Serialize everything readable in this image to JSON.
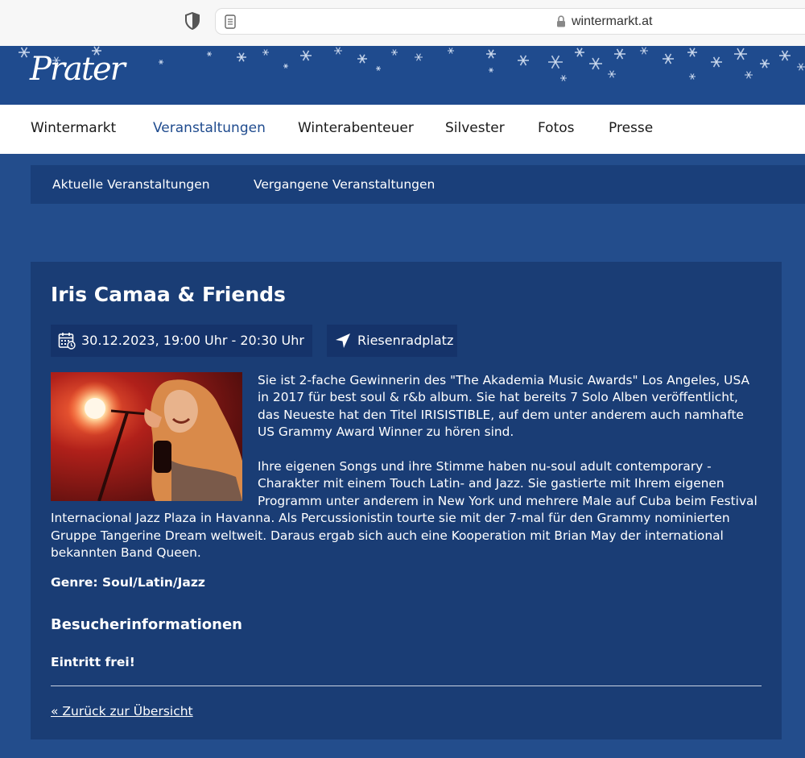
{
  "browser": {
    "url": "wintermarkt.at"
  },
  "header": {
    "logo_text": "Prater"
  },
  "main_nav": [
    {
      "label": "Wintermarkt"
    },
    {
      "label": "Veranstaltungen"
    },
    {
      "label": "Winterabenteuer"
    },
    {
      "label": "Silvester"
    },
    {
      "label": "Fotos"
    },
    {
      "label": "Presse"
    }
  ],
  "sub_nav": [
    {
      "label": "Aktuelle Veranstaltungen"
    },
    {
      "label": "Vergangene Veranstaltungen"
    }
  ],
  "event": {
    "title": "Iris Camaa & Friends",
    "datetime": "30.12.2023, 19:00 Uhr - 20:30 Uhr",
    "location": "Riesenradplatz",
    "paragraphs": [
      "Sie ist 2-fache Gewinnerin des \"The Akademia Music Awards\" Los Angeles, USA  in 2017 für best soul & r&b album. Sie hat bereits 7 Solo Alben veröffentlicht, das Neueste hat den Titel IRISISTIBLE, auf dem unter anderem auch namhafte US Grammy Award Winner zu hören sind.",
      "Ihre eigenen Songs und ihre Stimme haben nu-soul adult contemporary - Charakter mit einem Touch Latin- and Jazz. Sie gastierte mit Ihrem eigenen Programm unter anderem in New York und mehrere Male auf Cuba beim Festival Internacional Jazz Plaza in Havanna. Als Percussionistin tourte sie mit der 7-mal für den Grammy nominierten Gruppe Tangerine Dream weltweit. Daraus ergab sich auch eine Kooperation mit Brian May der international bekannten Band Queen."
    ],
    "genre": "Genre: Soul/Latin/Jazz",
    "visitor_heading": "Besucherinformationen",
    "entry": "Eintritt frei!",
    "back_link": "« Zurück zur Übersicht"
  },
  "colors": {
    "header_blue": "#1f4b8e",
    "page_blue": "#234d8c",
    "card_blue": "#1a3d75",
    "active_nav": "#1f4b8e"
  },
  "icons": [
    "shield-icon",
    "reader-icon",
    "lock-icon",
    "calendar-icon",
    "location-arrow-icon",
    "snowflake-icon"
  ]
}
